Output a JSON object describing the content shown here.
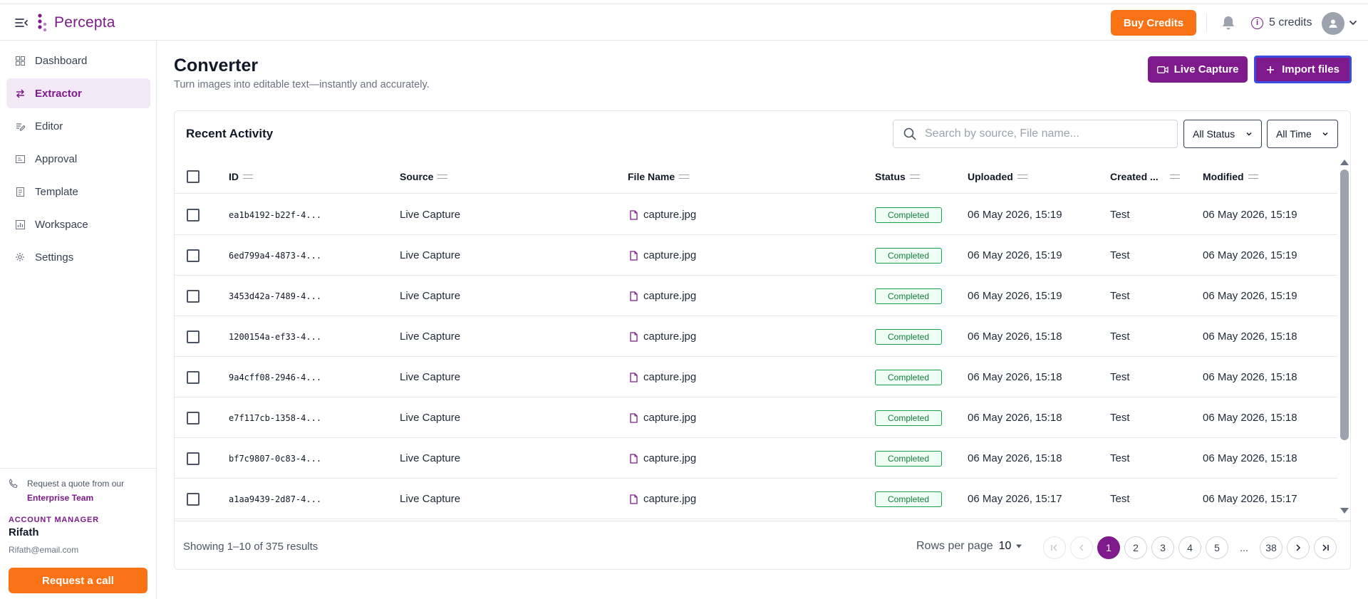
{
  "brand": {
    "name": "Percepta",
    "color": "#7e1a8c",
    "accent": "#f97316"
  },
  "topbar": {
    "buy_credits": "Buy Credits",
    "credits": "5 credits",
    "credit_icon": "i"
  },
  "sidebar": {
    "items": [
      {
        "label": "Dashboard",
        "icon": "grid-icon"
      },
      {
        "label": "Extractor",
        "icon": "arrows-icon",
        "active": true
      },
      {
        "label": "Editor",
        "icon": "edit-icon"
      },
      {
        "label": "Approval",
        "icon": "approval-icon"
      },
      {
        "label": "Template",
        "icon": "template-icon"
      },
      {
        "label": "Workspace",
        "icon": "chart-icon"
      },
      {
        "label": "Settings",
        "icon": "gear-icon"
      }
    ],
    "quote_text": "Request a quote from our",
    "quote_link": "Enterprise Team",
    "account_manager_label": "ACCOUNT MANAGER",
    "account_manager_name": "Rifath",
    "account_manager_email": "Rifath@email.com",
    "request_call": "Request a call"
  },
  "page": {
    "title": "Converter",
    "subtitle": "Turn images into editable text—instantly and accurately.",
    "live_capture": "Live Capture",
    "import_files": "Import files"
  },
  "activity": {
    "title": "Recent Activity",
    "search_placeholder": "Search by source, File name...",
    "status_filter": "All Status",
    "time_filter": "All Time",
    "columns": [
      "ID",
      "Source",
      "File Name",
      "Status",
      "Uploaded",
      "Created ...",
      "Modified"
    ],
    "rows": [
      {
        "id": "ea1b4192-b22f-4...",
        "source": "Live Capture",
        "file": "capture.jpg",
        "status": "Completed",
        "uploaded": "06 May 2026, 15:19",
        "created": "Test",
        "modified": "06 May 2026, 15:19"
      },
      {
        "id": "6ed799a4-4873-4...",
        "source": "Live Capture",
        "file": "capture.jpg",
        "status": "Completed",
        "uploaded": "06 May 2026, 15:19",
        "created": "Test",
        "modified": "06 May 2026, 15:19"
      },
      {
        "id": "3453d42a-7489-4...",
        "source": "Live Capture",
        "file": "capture.jpg",
        "status": "Completed",
        "uploaded": "06 May 2026, 15:19",
        "created": "Test",
        "modified": "06 May 2026, 15:19"
      },
      {
        "id": "1200154a-ef33-4...",
        "source": "Live Capture",
        "file": "capture.jpg",
        "status": "Completed",
        "uploaded": "06 May 2026, 15:18",
        "created": "Test",
        "modified": "06 May 2026, 15:18"
      },
      {
        "id": "9a4cff08-2946-4...",
        "source": "Live Capture",
        "file": "capture.jpg",
        "status": "Completed",
        "uploaded": "06 May 2026, 15:18",
        "created": "Test",
        "modified": "06 May 2026, 15:18"
      },
      {
        "id": "e7f117cb-1358-4...",
        "source": "Live Capture",
        "file": "capture.jpg",
        "status": "Completed",
        "uploaded": "06 May 2026, 15:18",
        "created": "Test",
        "modified": "06 May 2026, 15:18"
      },
      {
        "id": "bf7c9807-0c83-4...",
        "source": "Live Capture",
        "file": "capture.jpg",
        "status": "Completed",
        "uploaded": "06 May 2026, 15:18",
        "created": "Test",
        "modified": "06 May 2026, 15:18"
      },
      {
        "id": "a1aa9439-2d87-4...",
        "source": "Live Capture",
        "file": "capture.jpg",
        "status": "Completed",
        "uploaded": "06 May 2026, 15:17",
        "created": "Test",
        "modified": "06 May 2026, 15:17"
      }
    ],
    "showing": "Showing 1–10 of 375 results",
    "rows_per_page_label": "Rows per page",
    "rows_per_page": "10",
    "pages": [
      "1",
      "2",
      "3",
      "4",
      "5",
      "...",
      "38"
    ],
    "current_page": "1"
  }
}
